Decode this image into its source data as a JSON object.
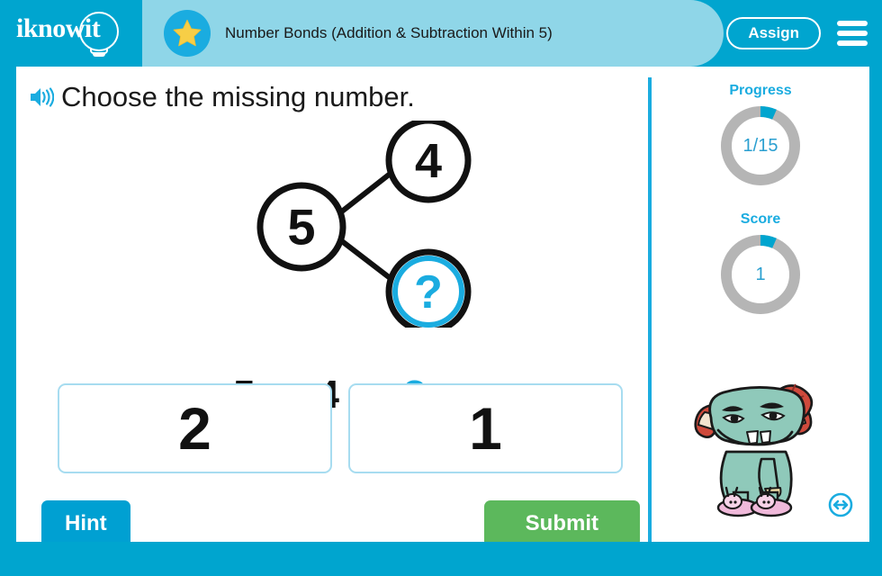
{
  "header": {
    "logo_text": "iknowit",
    "logo_icon": "lightbulb-icon",
    "star_icon": "star-icon",
    "activity_title": "Number Bonds (Addition & Subtraction Within 5)",
    "assign_label": "Assign",
    "menu_icon": "hamburger-menu-icon"
  },
  "question": {
    "speaker_icon": "speaker-audio-icon",
    "prompt": "Choose the missing number."
  },
  "number_bond": {
    "whole": "5",
    "part_top": "4",
    "part_bottom": "?",
    "bottom_is_unknown": true
  },
  "equation": {
    "left": "5",
    "operator": "–",
    "right": "4",
    "equals": "=",
    "result": "?"
  },
  "choices": [
    {
      "label": "2"
    },
    {
      "label": "1"
    }
  ],
  "actions": {
    "hint_label": "Hint",
    "submit_label": "Submit"
  },
  "sidebar": {
    "progress": {
      "title": "Progress",
      "value": "1/15",
      "current": 1,
      "total": 15
    },
    "score": {
      "title": "Score",
      "value": "1",
      "current": 1,
      "total": 15
    },
    "mascot_icon": "monster-mascot-character",
    "resize_icon": "resize-horizontal-arrow-icon"
  },
  "colors": {
    "brand_cyan": "#00a5cf",
    "title_band": "#8fd6e8",
    "accent_blue": "#1aace0",
    "submit_green": "#5cb85c",
    "hint_blue": "#00a0d2",
    "ring_track": "#b5b5b5",
    "choice_border": "#a7dcf0",
    "star_yellow": "#f7ce46"
  }
}
